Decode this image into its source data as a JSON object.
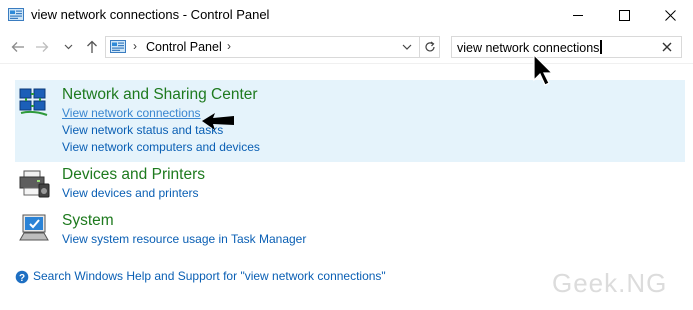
{
  "window": {
    "title": "view network connections - Control Panel",
    "icons": {
      "app": "control-panel-icon",
      "minimize": "minimize-icon",
      "maximize": "maximize-icon",
      "close": "close-icon"
    }
  },
  "navigation": {
    "back_icon": "back-arrow-icon",
    "forward_icon": "forward-arrow-icon",
    "recent_icon": "chevron-down-icon",
    "up_icon": "up-arrow-icon"
  },
  "address_bar": {
    "location": "Control Panel",
    "separator": "›"
  },
  "search": {
    "value": "view network connections"
  },
  "results": [
    {
      "title": "Network and Sharing Center",
      "icon": "network-sharing-icon",
      "links": [
        "View network connections",
        "View network status and tasks",
        "View network computers and devices"
      ],
      "selected": true
    },
    {
      "title": "Devices and Printers",
      "icon": "devices-printers-icon",
      "links": [
        "View devices and printers"
      ],
      "selected": false
    },
    {
      "title": "System",
      "icon": "system-icon",
      "links": [
        "View system resource usage in Task Manager"
      ],
      "selected": false
    }
  ],
  "help": {
    "text": "Search Windows Help and Support for \"view network connections\""
  },
  "watermark": "Geek.NG",
  "colors": {
    "result_title": "#1e7a1e",
    "link": "#0a5fb4",
    "selection": "#e5f3fb"
  }
}
